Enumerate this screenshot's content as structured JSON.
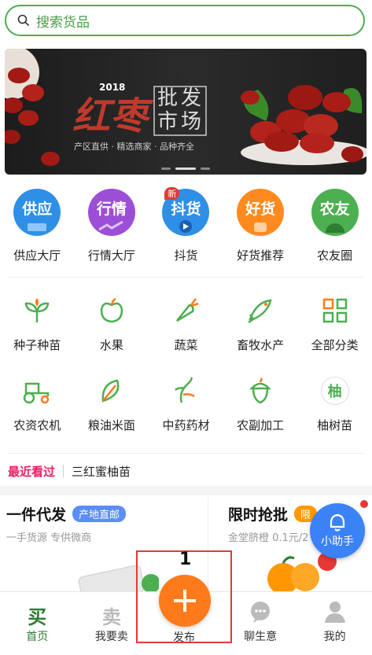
{
  "search": {
    "placeholder": "搜索货品",
    "icon": "search-icon"
  },
  "banner": {
    "year": "2018",
    "title_main": "红枣",
    "seal_chars": [
      "批",
      "发",
      "市",
      "场"
    ],
    "subtitle": "产区直供 · 精选商家 · 品种齐全"
  },
  "categories_primary": [
    {
      "icon_text": "供应",
      "label": "供应大厅",
      "color": "#2f8fe6",
      "badge": ""
    },
    {
      "icon_text": "行情",
      "label": "行情大厅",
      "color": "#9c4fd6",
      "badge": ""
    },
    {
      "icon_text": "抖货",
      "label": "抖货",
      "color": "#2f8fe6",
      "badge": "新"
    },
    {
      "icon_text": "好货",
      "label": "好货推荐",
      "color": "#ff8a1f",
      "badge": ""
    },
    {
      "icon_text": "农友",
      "label": "农友圈",
      "color": "#4caf50",
      "badge": ""
    }
  ],
  "categories_secondary": [
    [
      {
        "label": "种子种苗",
        "icon": "seedling-icon"
      },
      {
        "label": "水果",
        "icon": "apple-icon"
      },
      {
        "label": "蔬菜",
        "icon": "carrot-icon"
      },
      {
        "label": "畜牧水产",
        "icon": "fish-icon"
      },
      {
        "label": "全部分类",
        "icon": "grid-icon"
      }
    ],
    [
      {
        "label": "农资农机",
        "icon": "tractor-icon"
      },
      {
        "label": "粮油米面",
        "icon": "grain-icon"
      },
      {
        "label": "中药药材",
        "icon": "herb-icon"
      },
      {
        "label": "农副加工",
        "icon": "acorn-icon"
      },
      {
        "label": "柚树苗",
        "icon": "pomelo-icon",
        "glyph": "柚"
      }
    ]
  ],
  "recent": {
    "title": "最近看过",
    "item": "三红蜜柚苗"
  },
  "promo": {
    "left": {
      "title": "一件代发",
      "tag": "产地直邮",
      "desc": "一手货源  专供微商"
    },
    "right": {
      "title": "限时抢批",
      "tag": "限",
      "desc": "金堂脐橙 0.1元/2"
    }
  },
  "helper": {
    "label": "小助手",
    "icon": "bell-icon"
  },
  "tabbar": {
    "home": {
      "glyph": "买",
      "label": "首页"
    },
    "sell": {
      "glyph": "卖",
      "label": "我要卖"
    },
    "publish": {
      "label": "发布",
      "annotation": "1"
    },
    "chat": {
      "label": "聊生意"
    },
    "mine": {
      "label": "我的"
    }
  },
  "colors": {
    "accent": "#4caf50",
    "publish": "#ff7a1a",
    "annotation_box": "#e53935"
  }
}
